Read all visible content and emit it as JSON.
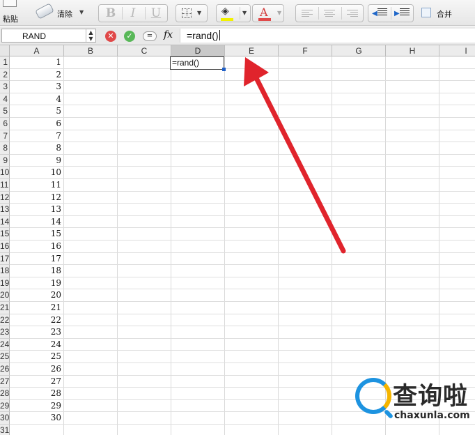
{
  "toolbar": {
    "paste_label": "粘贴",
    "clear_label": "清除",
    "bold_label": "B",
    "italic_label": "I",
    "underline_label": "U",
    "font_color_label": "A",
    "merge_label": "合并",
    "fill_color": "#f2f200",
    "font_color": "#e04a4a"
  },
  "formula_bar": {
    "name_box": "RAND",
    "fx_label": "fx",
    "formula": "=rand()"
  },
  "sheet": {
    "columns": [
      "A",
      "B",
      "C",
      "D",
      "E",
      "F",
      "G",
      "H",
      "I"
    ],
    "active_column": "D",
    "row_numbers": [
      "1",
      "2",
      "3",
      "4",
      "5",
      "6",
      "7",
      "8",
      "9",
      "10",
      "11",
      "12",
      "13",
      "14",
      "15",
      "16",
      "17",
      "18",
      "19",
      "20",
      "21",
      "22",
      "23",
      "24",
      "25",
      "26",
      "27",
      "28",
      "29",
      "30",
      "31"
    ],
    "column_a_values": [
      "1",
      "2",
      "3",
      "4",
      "5",
      "6",
      "7",
      "8",
      "9",
      "10",
      "11",
      "12",
      "13",
      "14",
      "15",
      "16",
      "17",
      "18",
      "19",
      "20",
      "21",
      "22",
      "23",
      "24",
      "25",
      "26",
      "27",
      "28",
      "29",
      "30"
    ],
    "active_cell_text": "=rand()"
  },
  "annotation": {
    "arrow_color": "#e0242c"
  },
  "watermark": {
    "text_cn": "查询啦",
    "text_en": "chaxunla.com"
  }
}
